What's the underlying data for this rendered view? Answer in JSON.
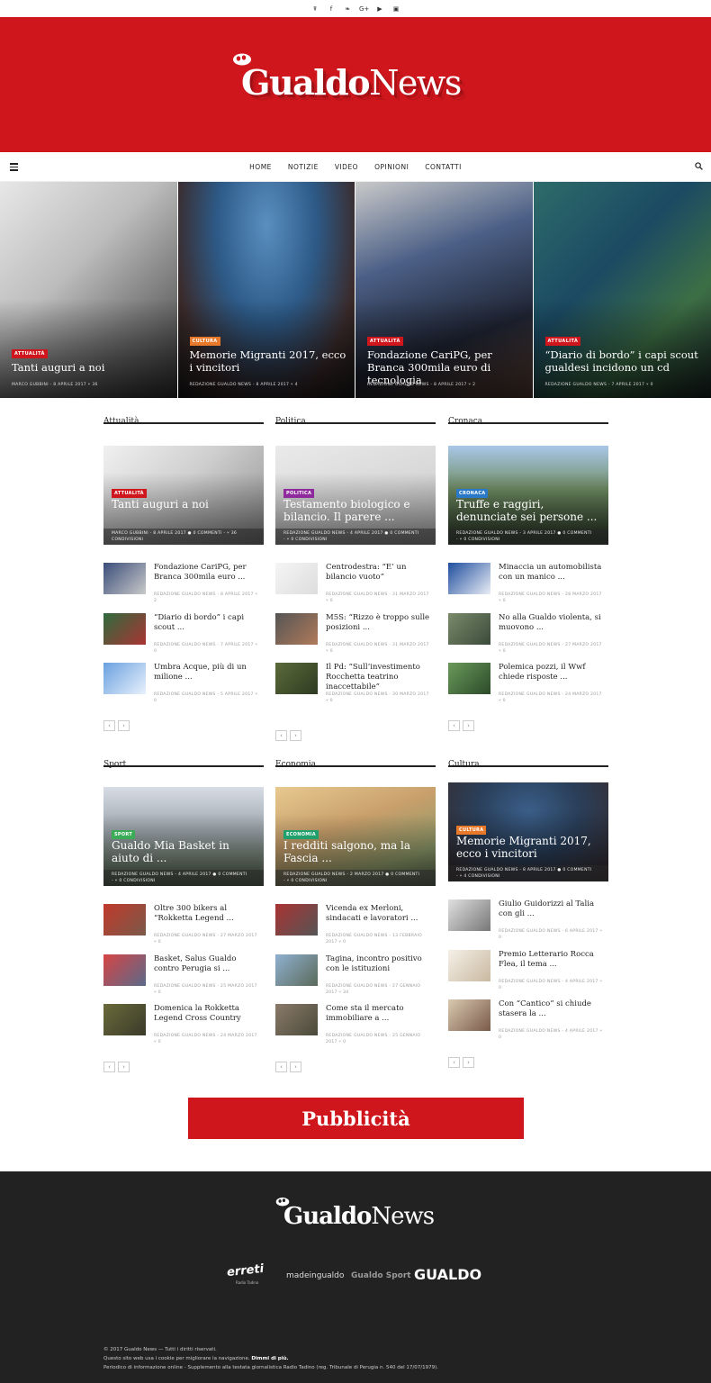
{
  "social": [
    "rss-icon",
    "facebook-icon",
    "twitter-icon",
    "google-plus-icon",
    "youtube-icon",
    "instagram-icon"
  ],
  "social_glyphs": [
    "☤",
    "f",
    "❧",
    "G+",
    "▶",
    "▣"
  ],
  "brand": {
    "logo_bold": "Gualdo",
    "logo_light": "News",
    "accent": "#d0161d"
  },
  "nav": {
    "items": [
      "HOME",
      "NOTIZIE",
      "VIDEO",
      "OPINIONI",
      "CONTATTI"
    ]
  },
  "hero": [
    {
      "category": "ATTUALITÀ",
      "cat_color": "#d0161d",
      "title": "Tanti auguri a noi",
      "meta": "MARCO GUBBINI - 8 APRILE 2017 ⑂ 36"
    },
    {
      "category": "CULTURA",
      "cat_color": "#e8792b",
      "title": "Memorie Migranti 2017, ecco i vincitori",
      "meta": "REDAZIONE GUALDO NEWS - 8 APRILE 2017 ⑂ 4"
    },
    {
      "category": "ATTUALITÀ",
      "cat_color": "#d0161d",
      "title": "Fondazione CariPG, per Branca 300mila euro di tecnologia",
      "meta": "REDAZIONE GUALDO NEWS - 8 APRILE 2017 ⑂ 2"
    },
    {
      "category": "ATTUALITÀ",
      "cat_color": "#d0161d",
      "title": "“Diario di bordo” i capi scout gualdesi incidono un cd",
      "meta": "REDAZIONE GUALDO NEWS - 7 APRILE 2017 ⑂ 0"
    }
  ],
  "sections": [
    {
      "heading": "Attualità",
      "featured": {
        "category": "ATTUALITÀ",
        "cat_color": "#d0161d",
        "title": "Tanti auguri a noi",
        "meta1": "MARCO GUBBINI - 8 APRILE 2017 ● 0 COMMENTI - ⑂ 36",
        "meta2": "CONDIVISIONI"
      },
      "items": [
        {
          "title": "Fondazione CariPG, per Branca 300mila euro ...",
          "meta": "REDAZIONE GUALDO NEWS - 8 APRILE 2017 ⑂ 2"
        },
        {
          "title": "“Diario di bordo” i capi scout ...",
          "meta": "REDAZIONE GUALDO NEWS - 7 APRILE 2017 ⑂ 0"
        },
        {
          "title": "Umbra Acque, più di un milione ...",
          "meta": "REDAZIONE GUALDO NEWS - 5 APRILE 2017 ⑂ 0"
        }
      ]
    },
    {
      "heading": "Politica",
      "featured": {
        "category": "POLITICA",
        "cat_color": "#8e2a9c",
        "title": "Testamento biologico e bilancio. Il parere ...",
        "meta1": "REDAZIONE GUALDO NEWS - 4 APRILE 2017 ● 0 COMMENTI",
        "meta2": "- ⑂ 0 CONDIVISIONI"
      },
      "items": [
        {
          "title": "Centrodestra: “E’ un bilancio vuoto”",
          "meta": "REDAZIONE GUALDO NEWS - 31 MARZO 2017 ⑂ 0"
        },
        {
          "title": "M5S: “Rizzo è troppo sulle posizioni ...",
          "meta": "REDAZIONE GUALDO NEWS - 31 MARZO 2017 ⑂ 0"
        },
        {
          "title": "Il Pd: “Sull’investimento Rocchetta teatrino inaccettabile”",
          "meta": "REDAZIONE GUALDO NEWS - 30 MARZO 2017 ⑂ 0"
        }
      ]
    },
    {
      "heading": "Cronaca",
      "featured": {
        "category": "CRONACA",
        "cat_color": "#2a79c9",
        "title": "Truffe e raggiri, denunciate sei persone ...",
        "meta1": "REDAZIONE GUALDO NEWS - 3 APRILE 2017 ● 0 COMMENTI",
        "meta2": "- ⑂ 0 CONDIVISIONI"
      },
      "items": [
        {
          "title": "Minaccia un automobilista con un manico ...",
          "meta": "REDAZIONE GUALDO NEWS - 28 MARZO 2017 ⑂ 0"
        },
        {
          "title": "No alla Gualdo violenta, si muovono ...",
          "meta": "REDAZIONE GUALDO NEWS - 27 MARZO 2017 ⑂ 0"
        },
        {
          "title": "Polemica pozzi, il Wwf chiede risposte ...",
          "meta": "REDAZIONE GUALDO NEWS - 24 MARZO 2017 ⑂ 0"
        }
      ]
    },
    {
      "heading": "Sport",
      "featured": {
        "category": "SPORT",
        "cat_color": "#3aab56",
        "title": "Gualdo Mia Basket in aiuto di ...",
        "meta1": "REDAZIONE GUALDO NEWS - 4 APRILE 2017 ● 0 COMMENTI",
        "meta2": "- ⑂ 0 CONDIVISIONI"
      },
      "items": [
        {
          "title": "Oltre 300 bikers al “Rokketta Legend ...",
          "meta": "REDAZIONE GUALDO NEWS - 27 MARZO 2017 ⑂ 0"
        },
        {
          "title": "Basket, Salus Gualdo contro Perugia si ...",
          "meta": "REDAZIONE GUALDO NEWS - 25 MARZO 2017 ⑂ 0"
        },
        {
          "title": "Domenica la Rokketta Legend Cross Country",
          "meta": "REDAZIONE GUALDO NEWS - 24 MARZO 2017 ⑂ 0"
        }
      ]
    },
    {
      "heading": "Economia",
      "featured": {
        "category": "ECONOMIA",
        "cat_color": "#20a06c",
        "title": "I redditi salgono, ma la Fascia ...",
        "meta1": "REDAZIONE GUALDO NEWS - 2 MARZO 2017 ● 0 COMMENTI",
        "meta2": "- ⑂ 0 CONDIVISIONI"
      },
      "items": [
        {
          "title": "Vicenda ex Merloni, sindacati e lavoratori ...",
          "meta": "REDAZIONE GUALDO NEWS - 13 FEBBRAIO 2017 ⑂ 0"
        },
        {
          "title": "Tagina, incontro positivo con le istituzioni",
          "meta": "REDAZIONE GUALDO NEWS - 27 GENNAIO 2017 ⑂ 34"
        },
        {
          "title": "Come sta il mercato immobiliare a ...",
          "meta": "REDAZIONE GUALDO NEWS - 25 GENNAIO 2017 ⑂ 0"
        }
      ]
    },
    {
      "heading": "Cultura",
      "featured": {
        "category": "CULTURA",
        "cat_color": "#e8792b",
        "title": "Memorie Migranti 2017, ecco i vincitori",
        "meta1": "REDAZIONE GUALDO NEWS - 8 APRILE 2017 ● 0 COMMENTI",
        "meta2": "- ⑂ 4 CONDIVISIONI"
      },
      "items": [
        {
          "title": "Giulio Guidorizzi al Talia con gli ...",
          "meta": "REDAZIONE GUALDO NEWS - 6 APRILE 2017 ⑂ 0"
        },
        {
          "title": "Premio Letterario Rocca Flea, il tema ...",
          "meta": "REDAZIONE GUALDO NEWS - 4 APRILE 2017 ⑂ 0"
        },
        {
          "title": "Con “Cantico” si chiude stasera la ...",
          "meta": "REDAZIONE GUALDO NEWS - 4 APRILE 2017 ⑂ 0"
        }
      ]
    }
  ],
  "pager": {
    "prev": "‹",
    "next": "›"
  },
  "ad": {
    "label": "Pubblicità"
  },
  "footer": {
    "partners": [
      "erreti",
      "madeingualdo",
      "Gualdo Sport",
      "GUALDO"
    ],
    "partner_sub": "Radio Tadino",
    "copyright": "© 2017 Gualdo News — Tutti i diritti riservati.",
    "cookie_text": "Questo sito web usa i cookie per migliorare la navigazione.",
    "cookie_link": "Dimmi di più.",
    "legal": "Periodico di informazione online - Supplemento alla testata giornalistica Radio Tadino (reg. Tribunale di Perugia n. 540 del 17/07/1979)."
  }
}
